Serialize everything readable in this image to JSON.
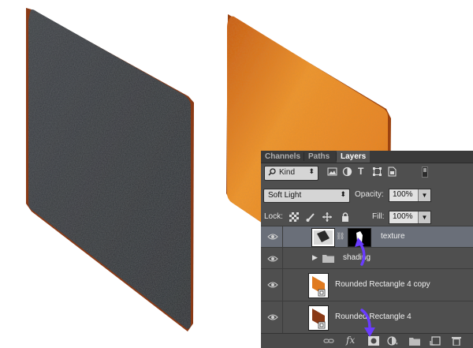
{
  "panel": {
    "tabs": [
      {
        "label": "Channels"
      },
      {
        "label": "Paths"
      },
      {
        "label": "Layers",
        "active": true
      }
    ],
    "filter": {
      "label": "Kind"
    },
    "blend_mode": "Soft Light",
    "opacity_label": "Opacity:",
    "opacity_value": "100%",
    "lock_label": "Lock:",
    "fill_label": "Fill:",
    "fill_value": "100%"
  },
  "layers": [
    {
      "name": "texture",
      "selected": true,
      "visible": true,
      "has_mask": true
    },
    {
      "name": "shading",
      "type": "group",
      "collapsed": true,
      "visible": true
    },
    {
      "name": "Rounded Rectangle 4 copy",
      "visible": true,
      "thumb_color": "#e07a1f"
    },
    {
      "name": "Rounded Rectangle 4",
      "visible": true,
      "thumb_color": "#8a3a16"
    }
  ],
  "colors": {
    "panel_bg": "#4f4f4f",
    "selected_row": "#6a6f79",
    "annotation_arrow": "#6a3cff",
    "leather_dark": "#2f3236",
    "leather_orange": "#e07a1f"
  }
}
